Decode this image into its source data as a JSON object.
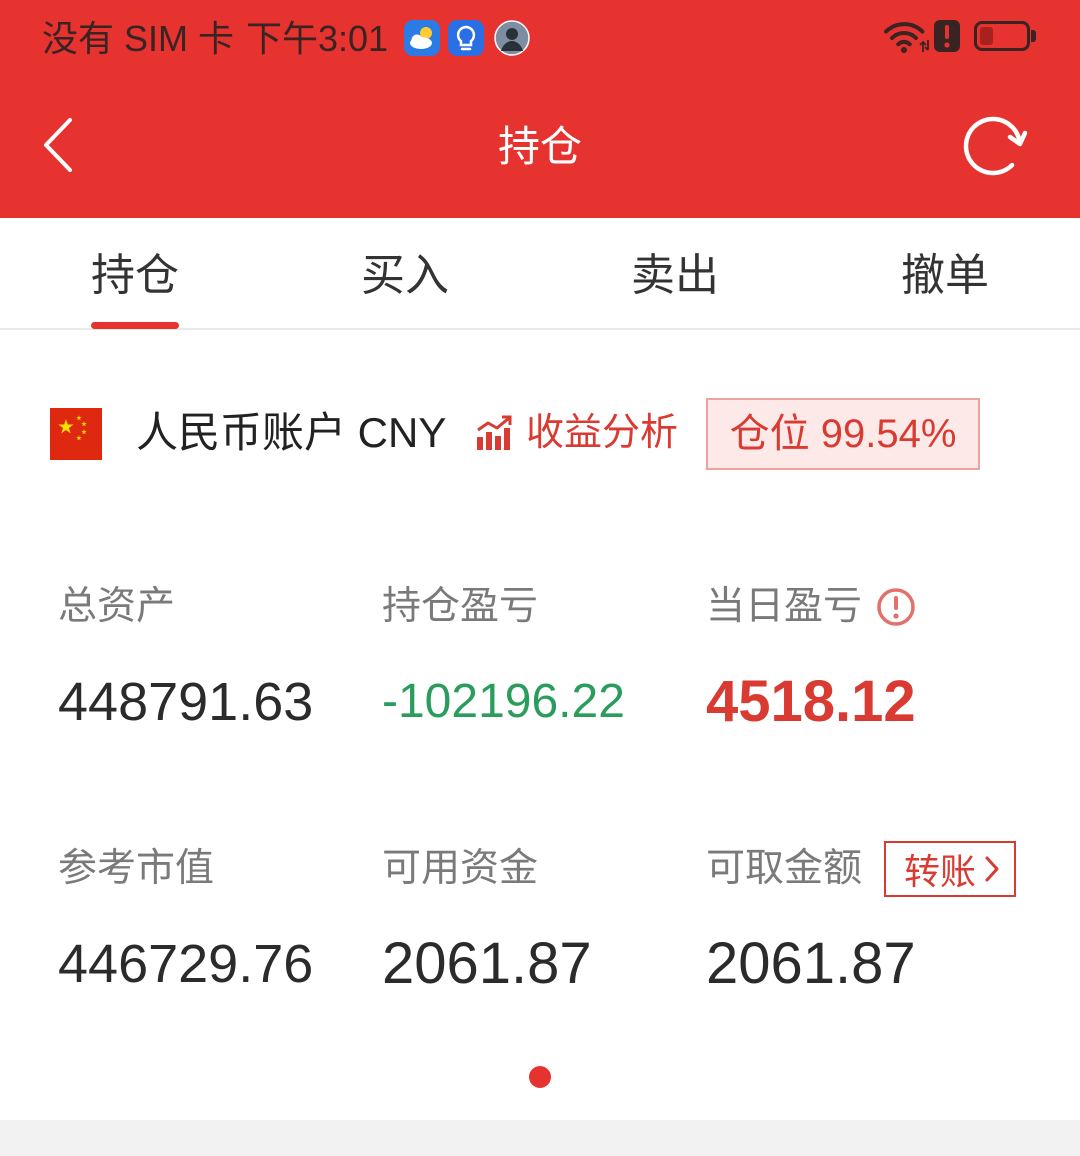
{
  "status_bar": {
    "carrier": "没有 SIM 卡",
    "time": "下午3:01",
    "app_icons": [
      "weather-icon",
      "lightbulb-icon",
      "avatar-icon"
    ],
    "system_icons": [
      "wifi-icon",
      "alert-icon",
      "battery-icon"
    ],
    "battery_level": 0.3
  },
  "header": {
    "title": "持仓",
    "back_icon": "chevron-left-icon",
    "refresh_icon": "refresh-icon"
  },
  "tabs": [
    {
      "label": "持仓",
      "active": true
    },
    {
      "label": "买入",
      "active": false
    },
    {
      "label": "卖出",
      "active": false
    },
    {
      "label": "撤单",
      "active": false
    }
  ],
  "account": {
    "flag_icon": "china-flag-icon",
    "name": "人民币账户 CNY",
    "analysis_icon": "bar-chart-icon",
    "analysis_label": "收益分析",
    "position_badge": "仓位 99.54%"
  },
  "stats": [
    {
      "label": "总资产",
      "value": "448791.63",
      "color": "#2b2b2b"
    },
    {
      "label": "持仓盈亏",
      "value": "-102196.22",
      "color": "#2a9d5c"
    },
    {
      "label": "当日盈亏",
      "value": "4518.12",
      "color": "#d93a32",
      "icon": "info-icon"
    },
    {
      "label": "参考市值",
      "value": "446729.76",
      "color": "#2b2b2b"
    },
    {
      "label": "可用资金",
      "value": "2061.87",
      "color": "#2b2b2b"
    },
    {
      "label": "可取金额",
      "value": "2061.87",
      "color": "#2b2b2b",
      "action": {
        "label": "转账",
        "icon": "chevron-right-icon"
      }
    }
  ],
  "page_indicator": {
    "count": 1,
    "active": 0
  },
  "colors": {
    "header_bg": "#e6332f",
    "accent": "#d93a32",
    "badge_bg": "#fde9e8",
    "badge_border": "#eba3a0"
  }
}
